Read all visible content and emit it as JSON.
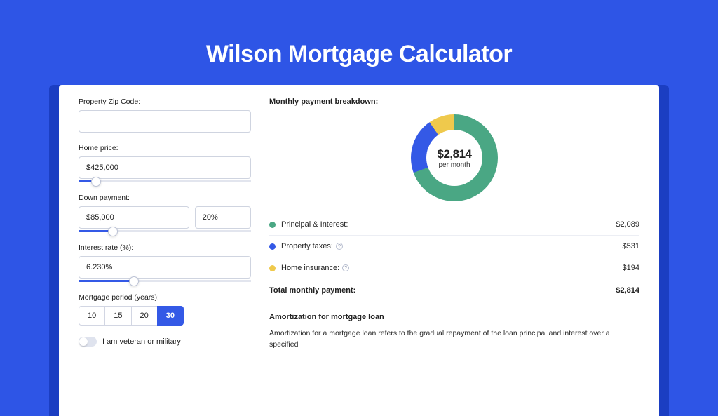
{
  "title": "Wilson Mortgage Calculator",
  "form": {
    "zip_label": "Property Zip Code:",
    "zip_value": "",
    "home_price_label": "Home price:",
    "home_price_value": "$425,000",
    "home_price_slider_pct": 10,
    "down_payment_label": "Down payment:",
    "down_payment_value": "$85,000",
    "down_payment_pct": "20%",
    "down_payment_slider_pct": 20,
    "interest_label": "Interest rate (%):",
    "interest_value": "6.230%",
    "interest_slider_pct": 32,
    "period_label": "Mortgage period (years):",
    "period_options": [
      "10",
      "15",
      "20",
      "30"
    ],
    "period_selected": "30",
    "veteran_label": "I am veteran or military"
  },
  "breakdown": {
    "title": "Monthly payment breakdown:",
    "donut_amount": "$2,814",
    "donut_sub": "per month",
    "rows": [
      {
        "label": "Principal & Interest:",
        "value": "$2,089",
        "color": "green",
        "info": false
      },
      {
        "label": "Property taxes:",
        "value": "$531",
        "color": "blue",
        "info": true
      },
      {
        "label": "Home insurance:",
        "value": "$194",
        "color": "yellow",
        "info": true
      }
    ],
    "total_label": "Total monthly payment:",
    "total_value": "$2,814"
  },
  "amortization": {
    "title": "Amortization for mortgage loan",
    "body": "Amortization for a mortgage loan refers to the gradual repayment of the loan principal and interest over a specified"
  },
  "chart_data": {
    "type": "pie",
    "title": "Monthly payment breakdown",
    "series": [
      {
        "name": "Principal & Interest",
        "value": 2089,
        "color": "#4aa784"
      },
      {
        "name": "Property taxes",
        "value": 531,
        "color": "#3459e6"
      },
      {
        "name": "Home insurance",
        "value": 194,
        "color": "#efc94c"
      }
    ],
    "total": 2814,
    "center_label": "$2,814 per month"
  }
}
